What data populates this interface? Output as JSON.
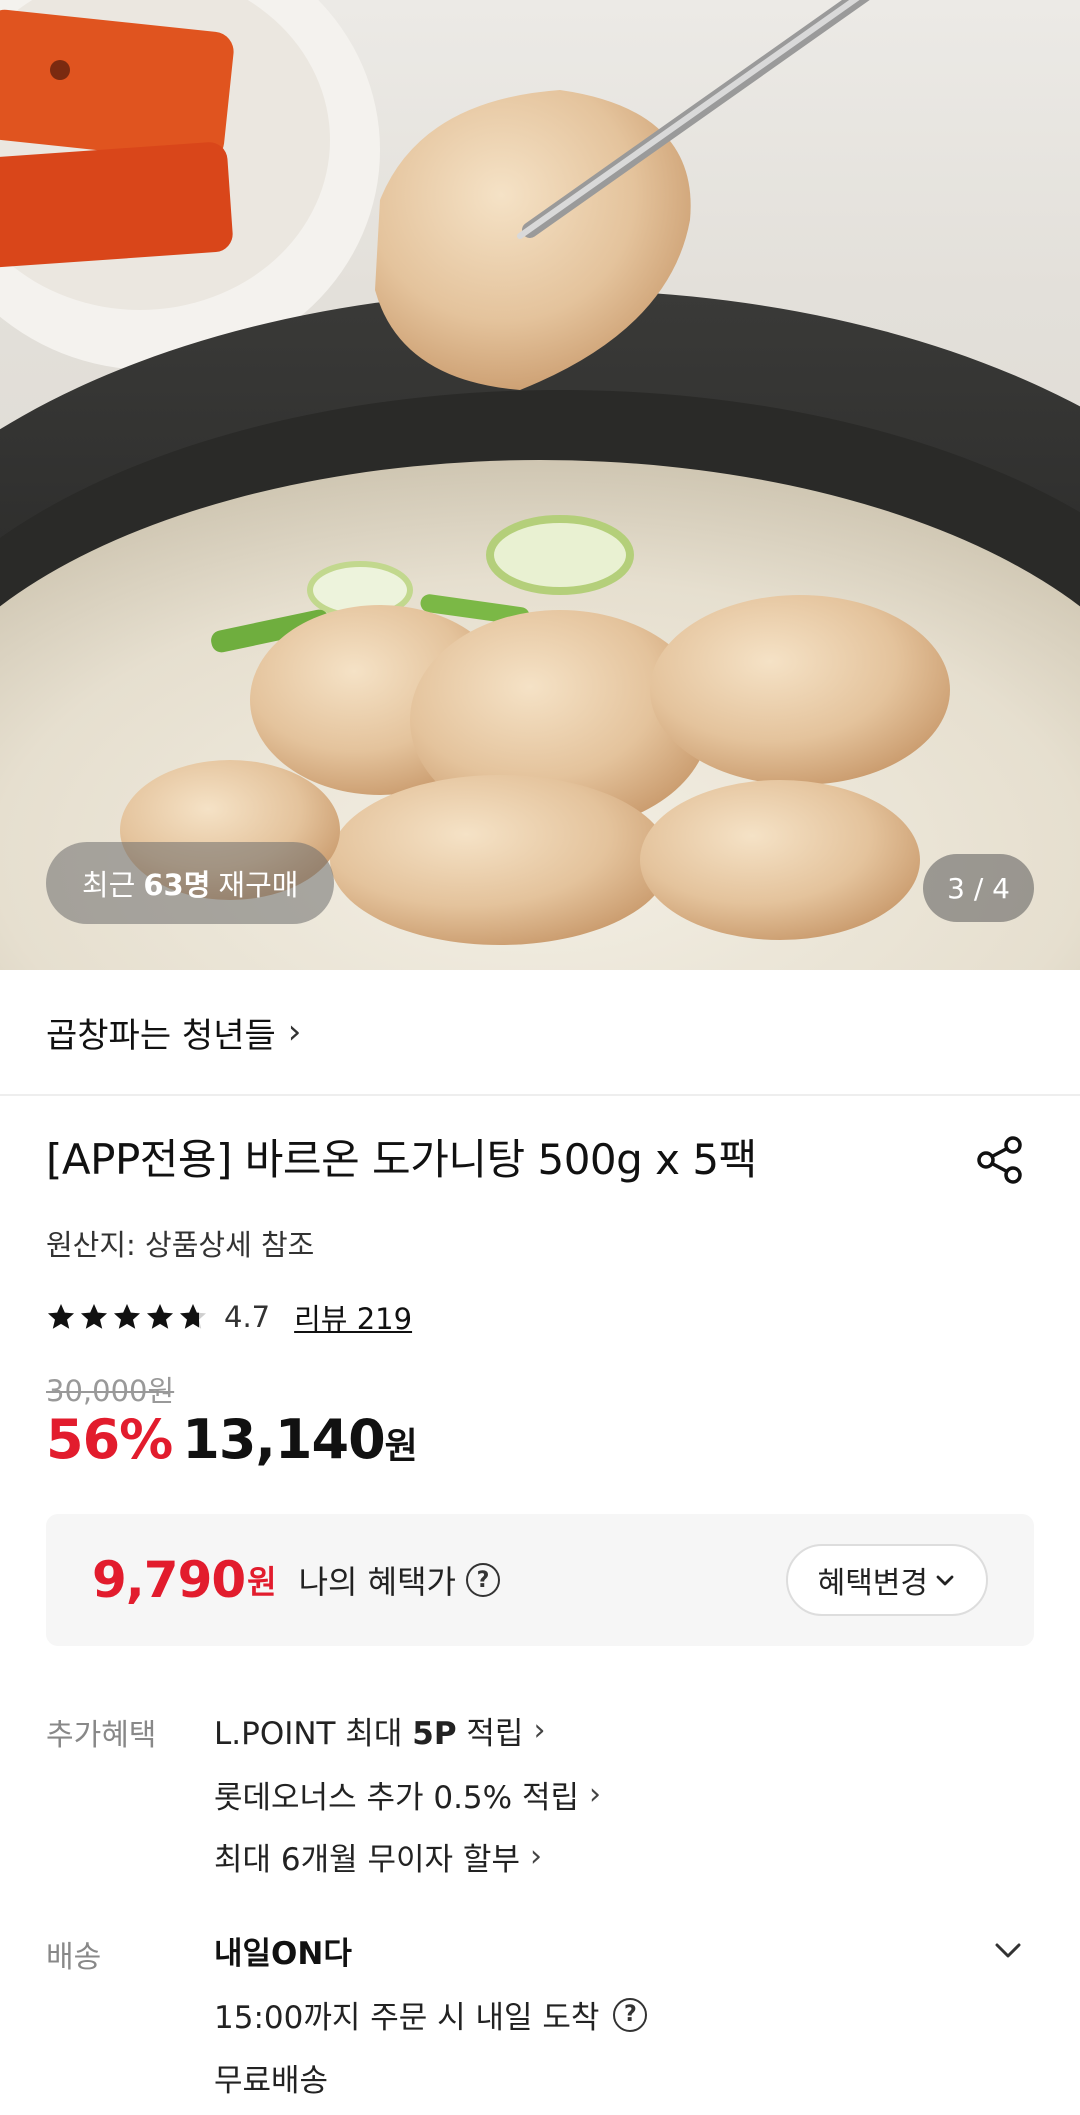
{
  "hero": {
    "repurchase_prefix": "최근",
    "repurchase_count": "63명",
    "repurchase_suffix": "재구매",
    "page_indicator": "3 / 4"
  },
  "store": {
    "name": "곱창파는 청년들",
    "chevron": "›"
  },
  "product": {
    "title": "[APP전용] 바르온 도가니탕 500g x 5팩",
    "origin": "원산지: 상품상세 참조",
    "rating": "4.7",
    "rating_stars_fraction": 0.94,
    "review_link": "리뷰 219",
    "original_price": "30,000원",
    "discount": "56%",
    "price": "13,140",
    "price_unit": "원"
  },
  "benefit": {
    "price": "9,790",
    "unit": "원",
    "label": "나의 혜택가",
    "help": "?",
    "change_button": "혜택변경"
  },
  "extra_benefits": {
    "label": "추가혜택",
    "items": [
      {
        "prefix": "L.POINT 최대 ",
        "bold": "5P",
        "suffix": " 적립"
      },
      {
        "prefix": "롯데오너스 추가 0.5% 적립",
        "bold": "",
        "suffix": ""
      },
      {
        "prefix": "최대 6개월 무이자 할부",
        "bold": "",
        "suffix": ""
      }
    ]
  },
  "delivery": {
    "label": "배송",
    "title": "내일ON다",
    "order_info": "15:00까지 주문 시 내일 도착",
    "help": "?",
    "shipping": "무료배송"
  },
  "colors": {
    "accent_red": "#e21c2d",
    "text": "#111111",
    "muted": "#888888"
  }
}
